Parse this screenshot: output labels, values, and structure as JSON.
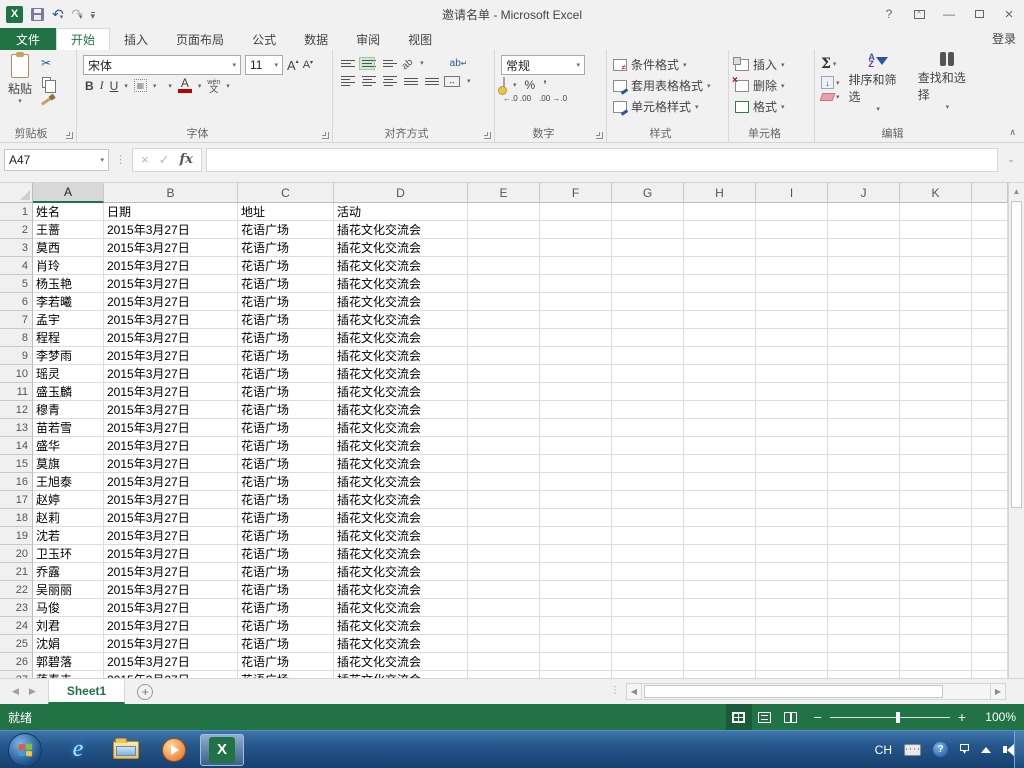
{
  "title_bar": {
    "title": "邀请名单 - Microsoft Excel",
    "help": "?",
    "minimize": "—",
    "close": "×"
  },
  "tab_row": {
    "file_tab": "文件",
    "tabs": [
      {
        "label": "开始",
        "active": true
      },
      {
        "label": "插入",
        "active": false
      },
      {
        "label": "页面布局",
        "active": false
      },
      {
        "label": "公式",
        "active": false
      },
      {
        "label": "数据",
        "active": false
      },
      {
        "label": "审阅",
        "active": false
      },
      {
        "label": "视图",
        "active": false
      }
    ],
    "sign_in": "登录"
  },
  "ribbon": {
    "clipboard": {
      "paste": "粘贴",
      "label": "剪贴板"
    },
    "font": {
      "name": "宋体",
      "size": "11",
      "bold": "B",
      "italic": "I",
      "underline": "U",
      "label": "字体"
    },
    "alignment": {
      "label": "对齐方式"
    },
    "number": {
      "format": "常规",
      "percent": "%",
      "comma": "’",
      "inc_dec": "←.0 .00",
      "dec_dec": ".00 →.0",
      "label": "数字"
    },
    "styles": {
      "items": [
        "条件格式",
        "套用表格格式",
        "单元格样式"
      ],
      "label": "样式"
    },
    "cells": {
      "items": [
        "插入",
        "删除",
        "格式"
      ],
      "label": "单元格"
    },
    "editing": {
      "sum": "Σ",
      "sort": "排序和筛选",
      "find": "查找和选择",
      "label": "编辑"
    }
  },
  "formula_bar": {
    "name_box": "A47",
    "fx": "fx",
    "value": ""
  },
  "grid": {
    "columns": [
      "A",
      "B",
      "C",
      "D",
      "E",
      "F",
      "G",
      "H",
      "I",
      "J",
      "K"
    ],
    "selected_column": "A",
    "header_row": [
      "姓名",
      "日期",
      "地址",
      "活动"
    ],
    "repeated": {
      "date": "2015年3月27日",
      "address": "花语广场",
      "activity": "插花文化交流会"
    },
    "names": [
      "王蔷",
      "莫西",
      "肖玲",
      "杨玉艳",
      "李若曦",
      "孟宇",
      "程程",
      "李梦雨",
      "瑶灵",
      "盛玉麟",
      "穆青",
      "苗若雪",
      "盛华",
      "莫旗",
      "王旭泰",
      "赵婷",
      "赵莉",
      "沈若",
      "卫玉环",
      "乔露",
      "吴丽丽",
      "马俊",
      "刘君",
      "沈娟",
      "郭碧落"
    ],
    "partial_row_name": "蒋春卉"
  },
  "sheet_bar": {
    "tab": "Sheet1",
    "add": "+"
  },
  "status_bar": {
    "status": "就绪",
    "zoom_level": "100%",
    "zoom_out": "−",
    "zoom_in": "+"
  },
  "taskbar": {
    "tray_language": "CH"
  },
  "colors": {
    "excel_green": "#217346",
    "selected_align": "#cfe8d4",
    "font_color_bar": "#c00000",
    "fill_color_bar": "#ffe400"
  }
}
